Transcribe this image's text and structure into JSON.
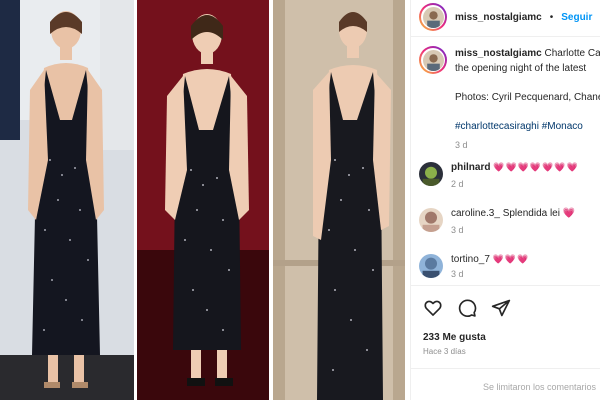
{
  "post": {
    "username": "miss_nostalgiamc",
    "separator": "•",
    "follow_label": "Seguir",
    "caption_line1": "Charlotte Cas",
    "caption_line2": "the opening night of the latest",
    "credits": "Photos: Cyril Pecquenard, Chane",
    "hashtags": "#charlottecasiraghi #Monaco",
    "caption_time": "3 d",
    "likes": "233 Me gusta",
    "age": "Hace 3 días",
    "comments_notice": "Se limitaron los comentarios"
  },
  "comments": [
    {
      "user": "philnard",
      "text": "💗💗💗💗💗💗💗",
      "time": "2 d"
    },
    {
      "user": "caroline.3_",
      "text": "Splendida lei 💗",
      "time": "3 d"
    },
    {
      "user": "tortino_7",
      "text": "💗💗💗",
      "time": "3 d"
    }
  ],
  "icons": {
    "like": "heart-icon",
    "comment": "comment-icon",
    "share": "send-icon"
  },
  "colors": {
    "link_blue": "#0095f6",
    "hashtag_blue": "#00376b",
    "meta_gray": "#8e8e8e"
  }
}
